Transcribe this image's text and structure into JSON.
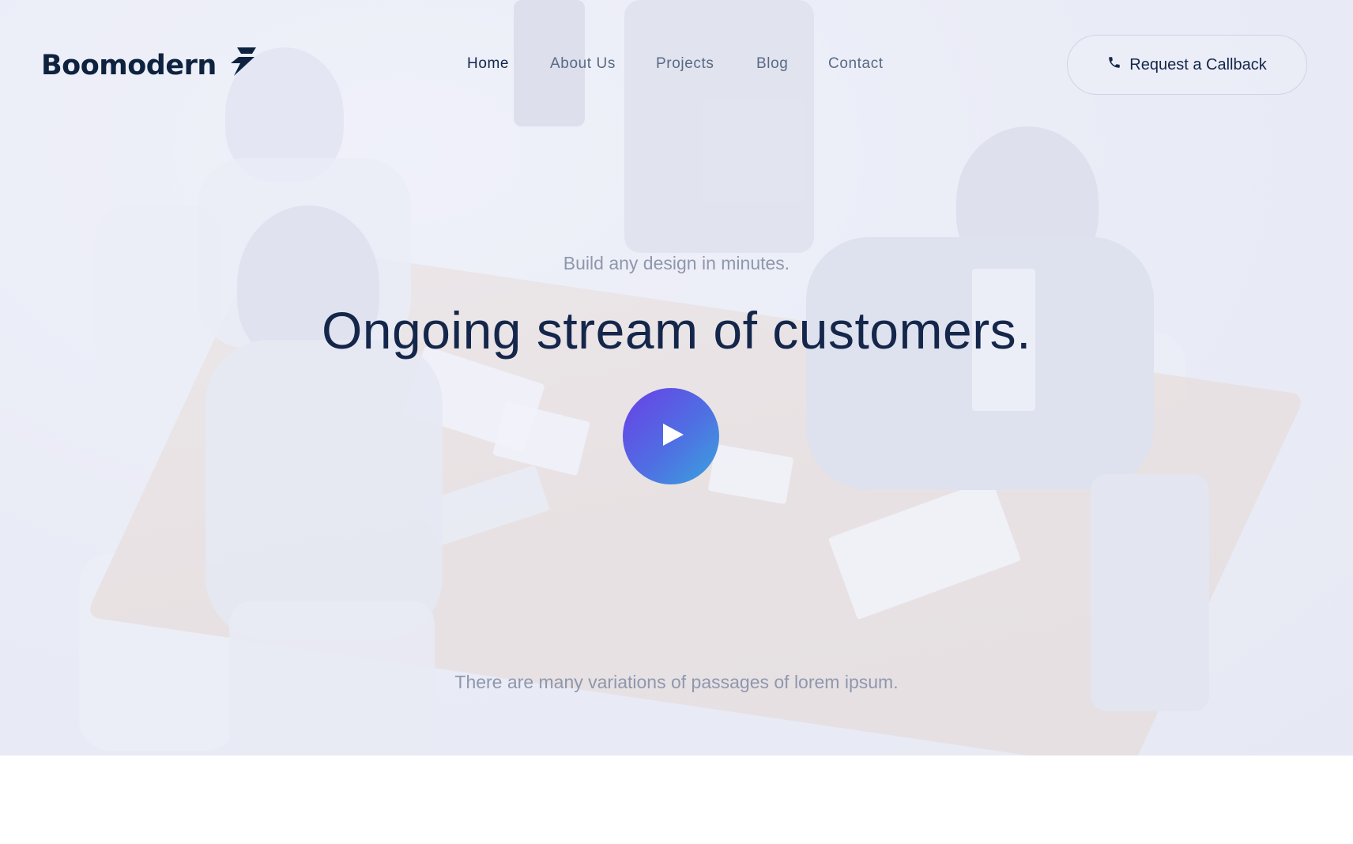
{
  "brand": {
    "name": "Boomodern",
    "logo_icon": "lightning-bolt-icon",
    "color": "#0e2240"
  },
  "nav": {
    "items": [
      {
        "label": "Home",
        "active": true
      },
      {
        "label": "About Us",
        "active": false
      },
      {
        "label": "Projects",
        "active": false
      },
      {
        "label": "Blog",
        "active": false
      },
      {
        "label": "Contact",
        "active": false
      }
    ]
  },
  "callback": {
    "label": "Request a Callback",
    "icon": "phone-icon"
  },
  "hero": {
    "tagline": "Build any design in minutes.",
    "headline": "Ongoing stream of customers.",
    "play_icon": "play-icon",
    "subtext": "There are many variations of passages of lorem ipsum.",
    "play_gradient": [
      "#6a3fe6",
      "#3aa4dd"
    ]
  }
}
